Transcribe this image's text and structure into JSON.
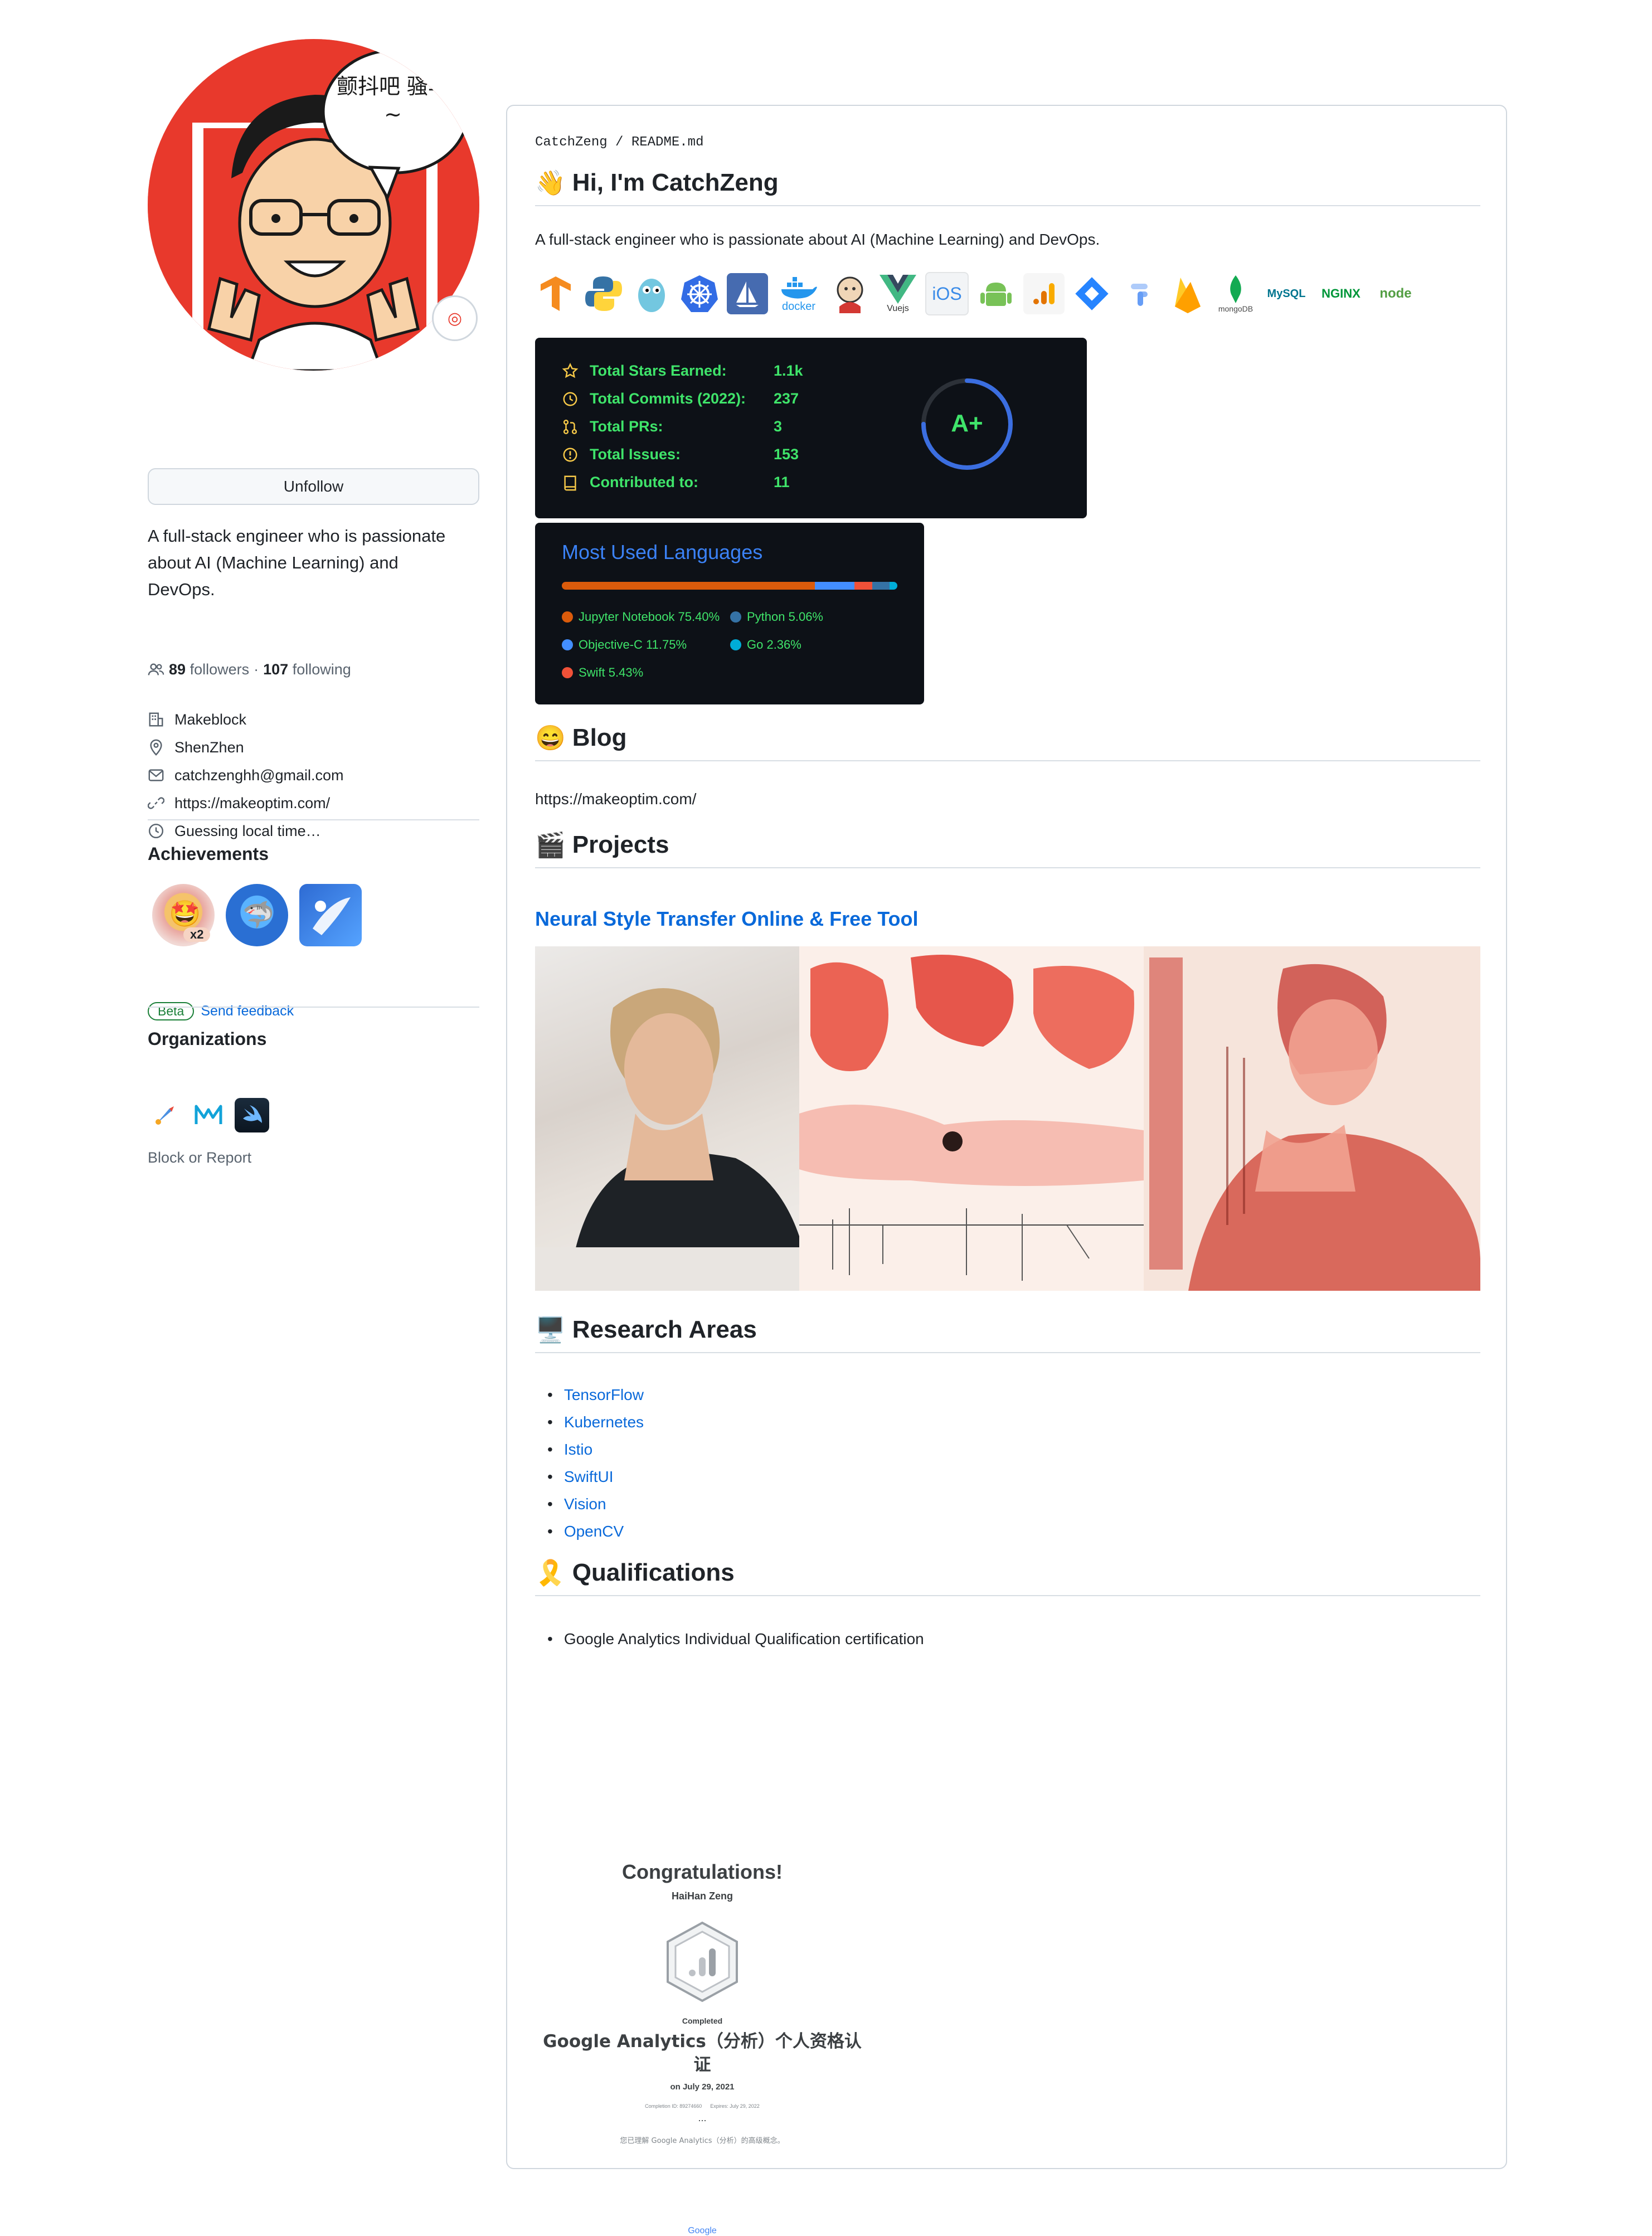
{
  "profile": {
    "avatar_bubble": "颤抖吧 骚年~",
    "unfollow_label": "Unfollow",
    "bio_line1": "A full-stack engineer who is passionate",
    "bio_line2": "about AI (Machine Learning) and",
    "bio_line3": "DevOps.",
    "followers_count": "89",
    "followers_label": "followers",
    "following_count": "107",
    "following_label": "following",
    "separator": "·",
    "company": "Makeblock",
    "location": "ShenZhen",
    "email": "catchzenghh@gmail.com",
    "website": "https://makeoptim.com/",
    "localtime": "Guessing local time…",
    "achievements_title": "Achievements",
    "achievement_multiplier": "x2",
    "beta_label": "Beta",
    "feedback_label": "Send feedback",
    "organizations_title": "Organizations",
    "block_label": "Block or Report"
  },
  "readme": {
    "crumb_user": "CatchZeng",
    "crumb_sep": "/",
    "crumb_file": "README.md",
    "hi_emoji": "👋",
    "hi_title": "Hi, I'm CatchZeng",
    "intro": "A full-stack engineer who is passionate about AI (Machine Learning) and DevOps.",
    "tech_icons": [
      "tensorflow-icon",
      "python-icon",
      "go-icon",
      "kubernetes-icon",
      "istio-icon",
      "docker-icon",
      "jenkins-icon",
      "vuejs-icon",
      "ios-icon",
      "android-icon",
      "google-analytics-icon",
      "jira-icon",
      "google-cloud-icon",
      "firebase-icon",
      "mongodb-icon",
      "mysql-icon",
      "nginx-icon",
      "nodejs-icon"
    ],
    "tech_text": {
      "docker": "docker",
      "vue": "Vuejs",
      "ios": "iOS",
      "mongo": "mongoDB",
      "mysql": "MySQL",
      "nginx": "NGINX",
      "node": "node"
    },
    "stats": {
      "rows": [
        {
          "label": "Total Stars Earned:",
          "value": "1.1k"
        },
        {
          "label": "Total Commits (2022):",
          "value": "237"
        },
        {
          "label": "Total PRs:",
          "value": "3"
        },
        {
          "label": "Total Issues:",
          "value": "153"
        },
        {
          "label": "Contributed to:",
          "value": "11"
        }
      ],
      "grade": "A+",
      "grade_progress": 0.75,
      "color_fg": "#3fe46a",
      "color_bg": "#0d1117"
    },
    "languages": {
      "title": "Most Used Languages",
      "items": [
        {
          "name": "Jupyter Notebook",
          "pct": 75.4,
          "label": "Jupyter Notebook 75.40%",
          "color": "#DA5B0B"
        },
        {
          "name": "Python",
          "pct": 5.06,
          "label": "Python 5.06%",
          "color": "#3572A5"
        },
        {
          "name": "Objective-C",
          "pct": 11.75,
          "label": "Objective-C 11.75%",
          "color": "#438eff"
        },
        {
          "name": "Go",
          "pct": 2.36,
          "label": "Go 2.36%",
          "color": "#00ADD8"
        },
        {
          "name": "Swift",
          "pct": 5.43,
          "label": "Swift 5.43%",
          "color": "#F05138"
        }
      ]
    },
    "blog_emoji": "😄",
    "blog_title": "Blog",
    "blog_link": "https://makeoptim.com/",
    "projects_emoji": "🎬",
    "projects_title": "Projects",
    "project_name": "Neural Style Transfer Online & Free Tool",
    "research_emoji": "🖥️",
    "research_title": "Research Areas",
    "research_items": [
      "TensorFlow",
      "Kubernetes",
      "Istio",
      "SwiftUI",
      "Vision",
      "OpenCV"
    ],
    "qual_emoji": "🎗️",
    "qual_title": "Qualifications",
    "qual_items": [
      "Google Analytics Individual Qualification certification"
    ],
    "certificate": {
      "congrats": "Congratulations!",
      "name": "HaiHan Zeng",
      "completed": "Completed",
      "course_line1": "Google Analytics（分析）个人资格认",
      "course_line2": "证",
      "date": "on July 29, 2021",
      "small_id": "Completion ID: 89274660",
      "small_expires": "Expires: July 29, 2022",
      "dots": "...",
      "footnote": "您已理解 Google Analytics（分析）的高级概念。",
      "brand": "Google"
    }
  }
}
